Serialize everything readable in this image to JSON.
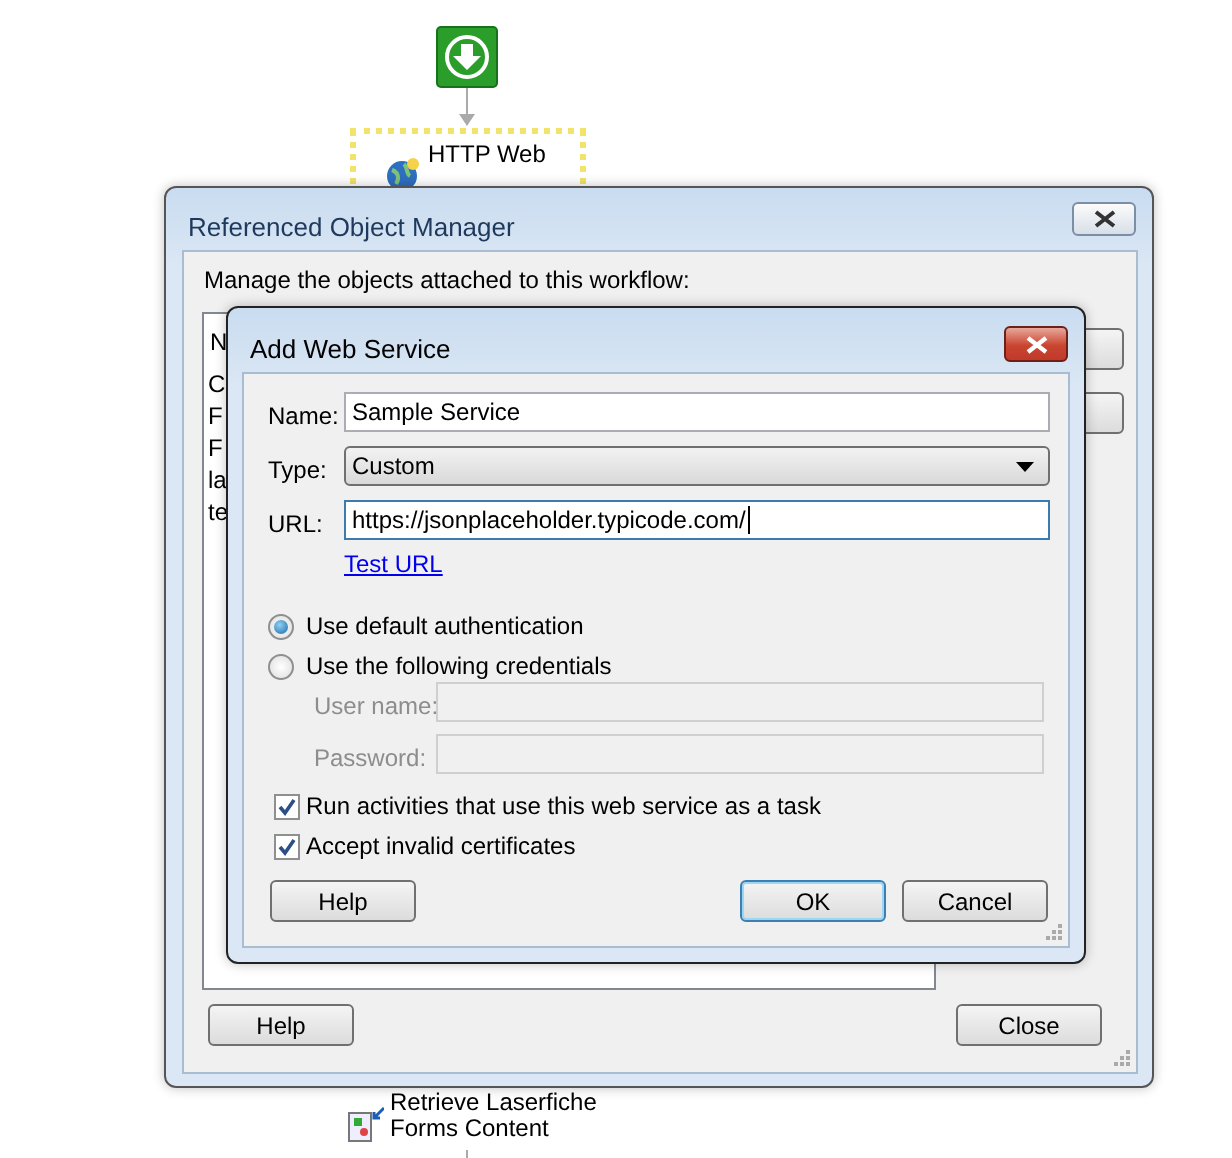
{
  "canvas": {
    "nodes": [
      {
        "label": "HTTP Web",
        "kind": "web",
        "selected": true
      },
      {
        "label": "Retrieve Laserfiche Forms Content",
        "kind": "forms",
        "selected": false
      }
    ]
  },
  "object_manager": {
    "title": "Referenced Object Manager",
    "instruction": "Manage the objects attached to this workflow:",
    "list": {
      "header": "N",
      "rows": [
        "C",
        "F",
        "F",
        "la",
        "te"
      ]
    },
    "buttons": [
      "Help",
      "Close"
    ]
  },
  "add_web_service": {
    "title": "Add Web Service",
    "fields": [
      {
        "label": "Name:",
        "kind": "text",
        "value": "Sample Service",
        "focused": false
      },
      {
        "label": "Type:",
        "kind": "select",
        "value": "Custom",
        "focused": false
      },
      {
        "label": "URL:",
        "kind": "text",
        "value": "https://jsonplaceholder.typicode.com/",
        "focused": true
      }
    ],
    "link": "Test URL",
    "auth_options": [
      {
        "label": "Use default authentication",
        "selected": true
      },
      {
        "label": "Use the following credentials",
        "selected": false
      }
    ],
    "credentials": [
      {
        "label": "User name:",
        "disabled": true
      },
      {
        "label": "Password:",
        "disabled": true
      }
    ],
    "options": [
      {
        "label": "Run activities that use this web service as a task",
        "checked": true
      },
      {
        "label": "Accept invalid certificates",
        "checked": true
      }
    ],
    "buttons": [
      {
        "label": "Help",
        "default": false
      },
      {
        "label": "OK",
        "default": true
      },
      {
        "label": "Cancel",
        "default": false
      }
    ]
  }
}
